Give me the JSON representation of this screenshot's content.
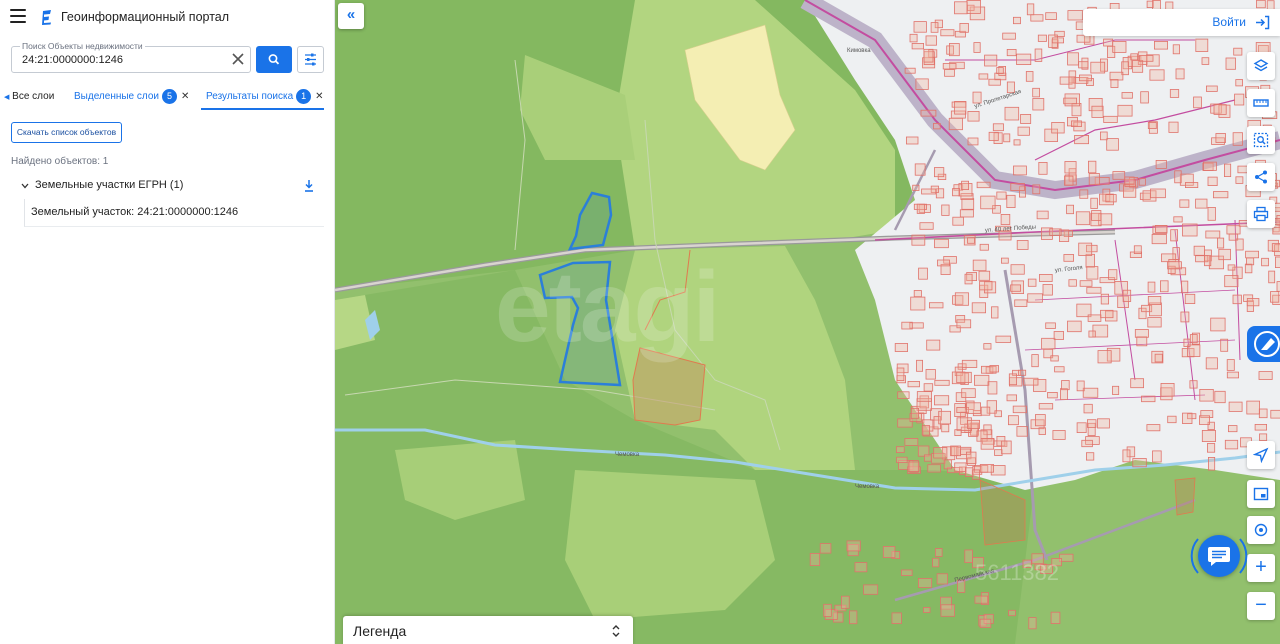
{
  "header": {
    "app_title": "Геоинформационный портал"
  },
  "search": {
    "label": "Поиск Объекты недвижимости",
    "value": "24:21:0000000:1246"
  },
  "tabs": [
    {
      "label": "Все слои"
    },
    {
      "label": "Выделенные слои",
      "count": "5"
    },
    {
      "label": "Результаты поиска",
      "count": "1"
    }
  ],
  "results": {
    "download_label": "Скачать список объектов",
    "found_text": "Найдено объектов: 1",
    "group_label": "Земельные участки ЕГРН (1)",
    "item_label": "Земельный участок: 24:21:0000000:1246"
  },
  "map": {
    "login_label": "Войти",
    "legend_label": "Легенда",
    "watermark": "etagi",
    "phone_watermark": "5611382",
    "street_labels": [
      "Кимовка",
      "ул. Пролетарская",
      "ул. 40 лет Победы",
      "ул. Гоголя",
      "Чемовка",
      "Чемовка",
      "Первомайская"
    ],
    "tools": [
      "layers-icon",
      "ruler-icon",
      "select-area-icon",
      "share-icon",
      "print-icon",
      "navigate-icon",
      "minimap-icon",
      "locate-icon",
      "zoom-in-icon",
      "zoom-out-icon"
    ]
  },
  "colors": {
    "accent": "#1a73e8",
    "forest": "#8fbf6a",
    "meadow": "#bcd98a",
    "parcel_highlight": "#2b7fd9",
    "building_outline": "#e0726a",
    "road": "#c34da0"
  }
}
